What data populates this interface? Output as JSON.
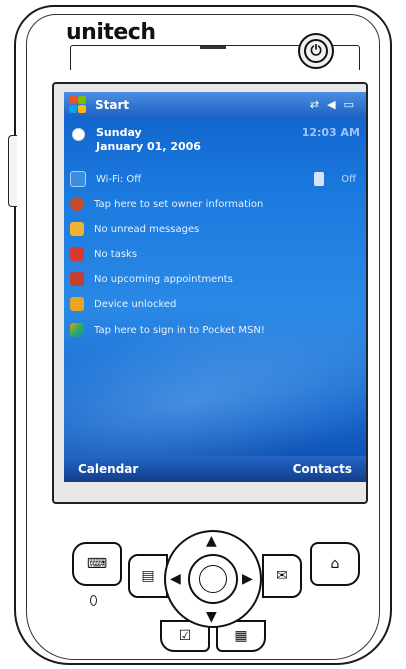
{
  "device": {
    "brand": "unitech"
  },
  "taskbar": {
    "start_label": "Start"
  },
  "today": {
    "day": "Sunday",
    "date": "January 01, 2006",
    "time": "12:03 AM",
    "items": [
      {
        "label": "Wi-Fi: Off",
        "icon": "wifi-icon",
        "status": "Off"
      },
      {
        "label": "Tap here to set owner information",
        "icon": "owner-icon"
      },
      {
        "label": "No unread messages",
        "icon": "messages-icon"
      },
      {
        "label": "No tasks",
        "icon": "tasks-icon"
      },
      {
        "label": "No upcoming appointments",
        "icon": "calendar-icon"
      },
      {
        "label": "Device unlocked",
        "icon": "lock-icon"
      },
      {
        "label": "Tap here to sign in to Pocket MSN!",
        "icon": "msn-icon"
      }
    ]
  },
  "softkeys": {
    "left": "Calendar",
    "right": "Contacts"
  },
  "colors": {
    "screen_top": "#0f5fc8",
    "screen_bottom": "#0c46a3",
    "outline": "#111111"
  }
}
